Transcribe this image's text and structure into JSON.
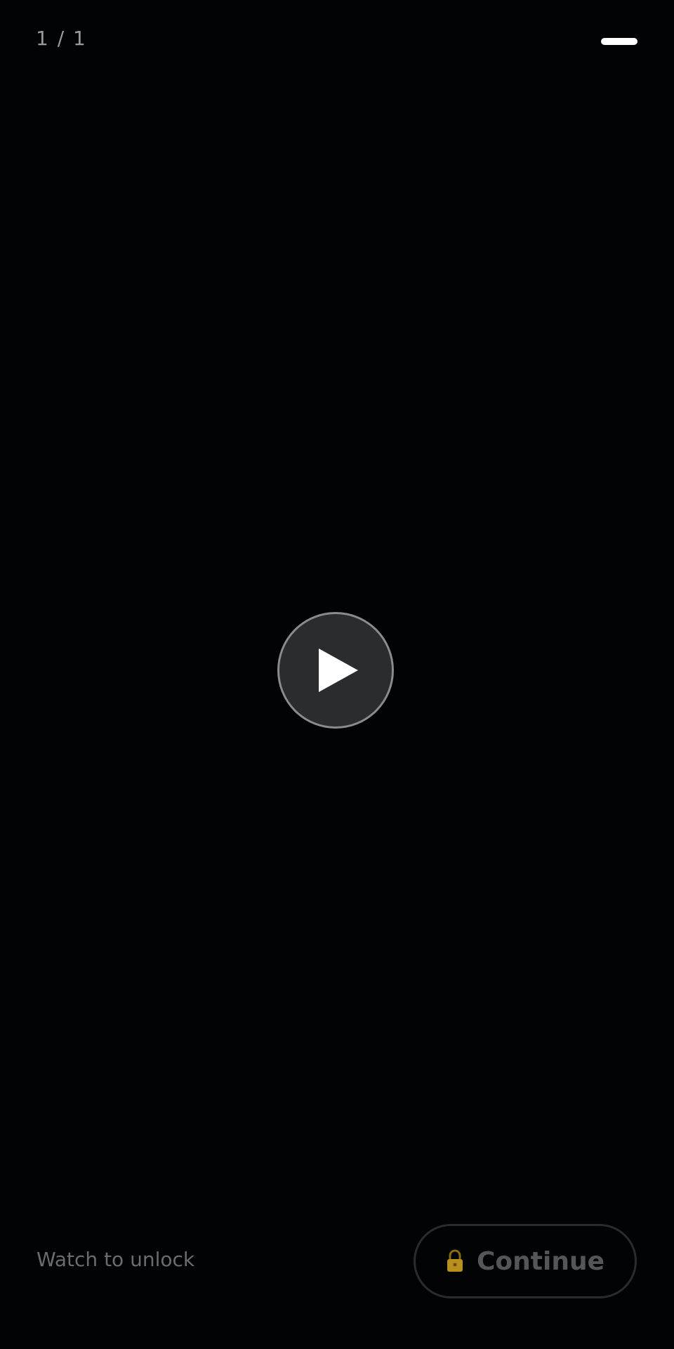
{
  "header": {
    "page_indicator": "1 / 1",
    "menu_icon": "menu-bar-icon"
  },
  "video": {
    "play_icon": "play-icon"
  },
  "footer": {
    "status_text": "Watch to unlock",
    "continue_label": "Continue",
    "lock_icon": "lock-icon"
  },
  "colors": {
    "background": "#020304",
    "play_button_fill": "#2b2c2d",
    "play_button_border": "#8a8b8c",
    "lock_icon": "#c9a227",
    "disabled_text": "#545658"
  }
}
